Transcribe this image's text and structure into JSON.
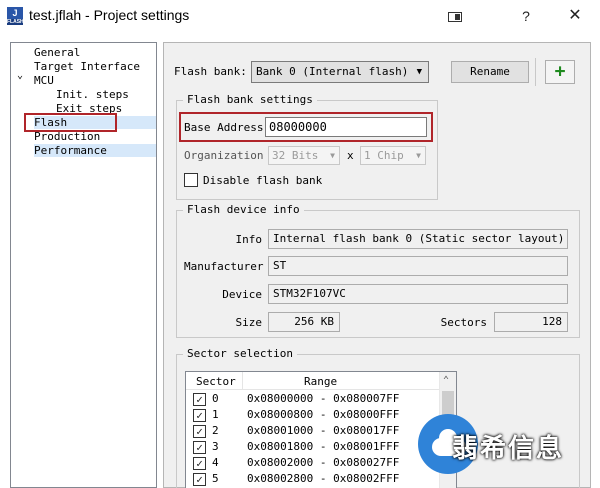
{
  "window": {
    "title": "test.jflah - Project settings",
    "app_icon_text": "J",
    "app_icon_sub": "FLASH"
  },
  "tree": {
    "items": [
      {
        "label": "General"
      },
      {
        "label": "Target Interface"
      },
      {
        "label": "MCU"
      },
      {
        "label": "Init. steps"
      },
      {
        "label": "Exit steps"
      },
      {
        "label": "Flash"
      },
      {
        "label": "Production"
      },
      {
        "label": "Performance"
      }
    ]
  },
  "toolbar": {
    "flash_bank_label": "Flash bank:",
    "flash_bank_value": "Bank 0 (Internal flash)",
    "rename_label": "Rename",
    "add_label": "+"
  },
  "bank_settings": {
    "title": "Flash bank settings",
    "base_address_label": "Base Address",
    "base_address_value": "08000000",
    "organization_label": "Organization",
    "org_bits_value": "32 Bits",
    "org_x": "x",
    "org_chip_value": "1 Chip",
    "disable_label": "Disable flash bank"
  },
  "device_info": {
    "title": "Flash device info",
    "info_label": "Info",
    "info_value": "Internal flash bank 0 (Static sector layout)",
    "manufacturer_label": "Manufacturer",
    "manufacturer_value": "ST",
    "device_label": "Device",
    "device_value": "STM32F107VC",
    "size_label": "Size",
    "size_value": "256 KB",
    "sectors_label": "Sectors",
    "sectors_value": "128"
  },
  "sector_selection": {
    "title": "Sector selection",
    "col_sector": "Sector",
    "col_range": "Range",
    "rows": [
      {
        "num": "0",
        "range": "0x08000000 - 0x080007FF",
        "checked": true
      },
      {
        "num": "1",
        "range": "0x08000800 - 0x08000FFF",
        "checked": true
      },
      {
        "num": "2",
        "range": "0x08001000 - 0x080017FF",
        "checked": true
      },
      {
        "num": "3",
        "range": "0x08001800 - 0x08001FFF",
        "checked": true
      },
      {
        "num": "4",
        "range": "0x08002000 - 0x080027FF",
        "checked": true
      },
      {
        "num": "5",
        "range": "0x08002800 - 0x08002FFF",
        "checked": true
      }
    ]
  },
  "watermark": {
    "text": "翡希信息"
  }
}
